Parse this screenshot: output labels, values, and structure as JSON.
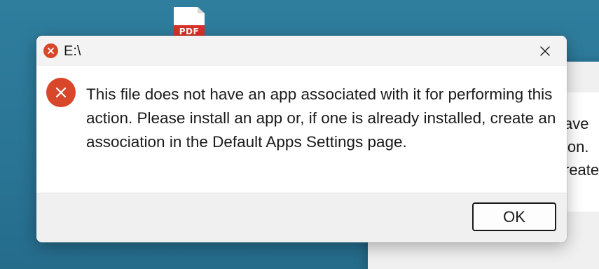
{
  "desktop": {
    "pdf_icon": {
      "icon": "pdf-file-icon",
      "label": "PDF",
      "color": "#d9322b"
    }
  },
  "background_dialog": {
    "visible_text_lines": [
      "ave",
      "ion.",
      "reate"
    ]
  },
  "dialog": {
    "title": "E:\\",
    "title_icon": "error-icon",
    "close_icon": "close-icon",
    "message_icon": "error-icon",
    "message": "This file does not have an app associated with it for performing this action. Please install an app or, if one is already installed, create an association in the Default Apps Settings page.",
    "ok_label": "OK",
    "accent_color": "#d9472b"
  }
}
